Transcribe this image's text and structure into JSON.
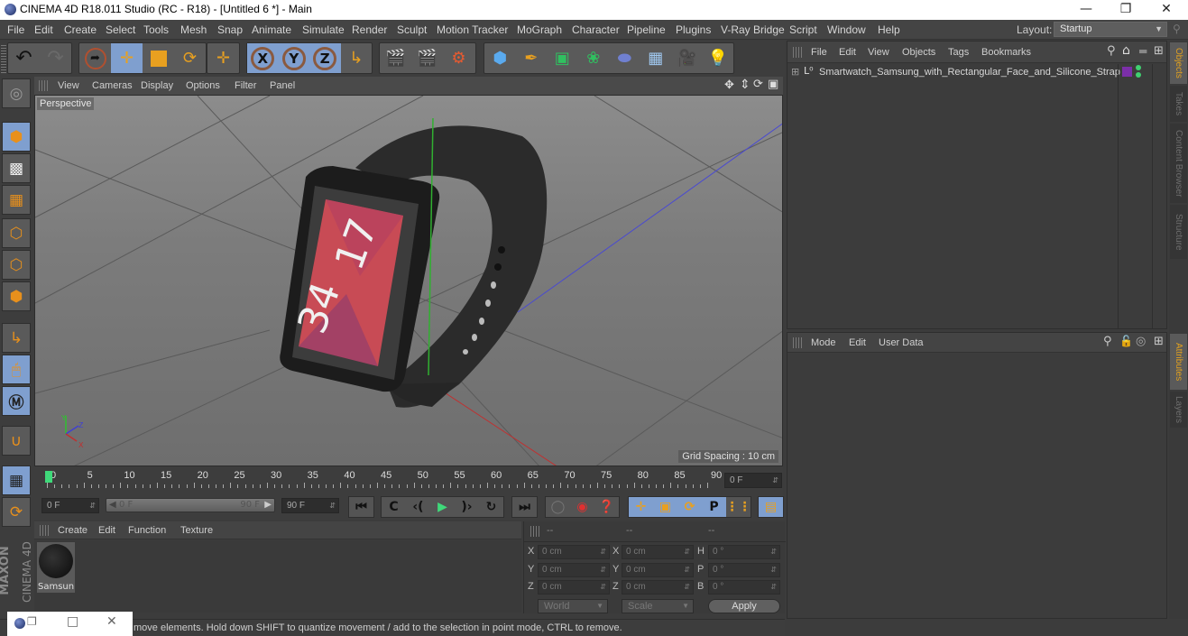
{
  "window": {
    "title": "CINEMA 4D R18.011 Studio (RC - R18) - [Untitled 6 *] - Main",
    "controls": [
      "minimize",
      "restore",
      "close"
    ]
  },
  "menubar": {
    "items": [
      "File",
      "Edit",
      "Create",
      "Select",
      "Tools",
      "Mesh",
      "Snap",
      "Animate",
      "Simulate",
      "Render",
      "Sculpt",
      "Motion Tracker",
      "MoGraph",
      "Character",
      "Pipeline",
      "Plugins",
      "V-Ray Bridge",
      "Script",
      "Window",
      "Help"
    ],
    "layout_label": "Layout:",
    "layout_value": "Startup"
  },
  "toolbar": {
    "groups": [
      [
        "undo-icon",
        "redo-icon"
      ],
      [
        "live-selection-icon",
        "move-icon",
        "scale-icon",
        "rotate-icon"
      ],
      [
        "recent-tool-icon"
      ],
      [
        "x-axis-lock-icon",
        "y-axis-lock-icon",
        "z-axis-lock-icon",
        "coordinate-system-icon"
      ],
      [
        "render-view-icon",
        "render-to-picture-viewer-icon",
        "render-settings-icon"
      ],
      [
        "cube-icon",
        "pen-spline-icon",
        "subdivision-surface-icon",
        "cloner-icon",
        "deformer-icon",
        "floor-icon",
        "camera-icon",
        "light-icon"
      ]
    ],
    "axis_labels": [
      "X",
      "Y",
      "Z"
    ]
  },
  "viewport": {
    "menu": [
      "View",
      "Cameras",
      "Display",
      "Options",
      "Filter",
      "Panel"
    ],
    "camera_label": "Perspective",
    "grid_spacing": "Grid Spacing : 10 cm",
    "watch_time": [
      "17",
      "34"
    ],
    "nav_icons": [
      "move-view-icon",
      "zoom-view-icon",
      "rotate-view-icon",
      "toggle-view-icon"
    ]
  },
  "left_tools": [
    "make-editable-icon",
    "model-mode-icon",
    "texture-mode-icon",
    "workplane-mode-icon",
    "points-mode-icon",
    "edges-mode-icon",
    "polygons-mode-icon",
    "axis-mode-icon",
    "tweak-mode-icon",
    "solo-mode-icon",
    "snap-icon",
    "workplane-lock-icon",
    "planar-workplane-icon"
  ],
  "timeline": {
    "ticks": [
      "0",
      "5",
      "10",
      "15",
      "20",
      "25",
      "30",
      "35",
      "40",
      "45",
      "50",
      "55",
      "60",
      "65",
      "70",
      "75",
      "80",
      "85",
      "90"
    ],
    "current_frame": "0 F",
    "start_field": "0 F",
    "range_start": "0 F",
    "range_end": "90 F",
    "end_field": "90 F",
    "playhead_fraction": 0.0
  },
  "playback": {
    "buttons": [
      "go-to-start-icon",
      "previous-key-icon",
      "previous-frame-icon",
      "play-icon",
      "next-frame-icon",
      "next-key-icon",
      "go-to-end-icon"
    ],
    "record_buttons": [
      "motion-record-icon",
      "record-active-objects-icon",
      "autokeying-icon"
    ],
    "key_buttons": [
      "record-position-icon",
      "record-scale-icon",
      "record-rotation-icon",
      "record-parameter-icon",
      "record-point-level-icon"
    ],
    "timeline_button": "timeline-window-icon",
    "param_label": "P"
  },
  "material_manager": {
    "menu": [
      "Create",
      "Edit",
      "Function",
      "Texture"
    ],
    "materials": [
      {
        "name": "Samsun"
      }
    ]
  },
  "coordinates": {
    "headers": [
      "--",
      "--",
      "--"
    ],
    "rows": [
      {
        "pos_label": "X",
        "pos": "0 cm",
        "size_label": "X",
        "size": "0 cm",
        "rot_label": "H",
        "rot": "0 °"
      },
      {
        "pos_label": "Y",
        "pos": "0 cm",
        "size_label": "Y",
        "size": "0 cm",
        "rot_label": "P",
        "rot": "0 °"
      },
      {
        "pos_label": "Z",
        "pos": "0 cm",
        "size_label": "Z",
        "size": "0 cm",
        "rot_label": "B",
        "rot": "0 °"
      }
    ],
    "space_select": "World",
    "mode_select": "Scale",
    "apply_label": "Apply"
  },
  "objects_panel": {
    "menu": [
      "File",
      "Edit",
      "View",
      "Objects",
      "Tags",
      "Bookmarks"
    ],
    "objects": [
      {
        "name": "Smartwatch_Samsung_with_Rectangular_Face_and_Silicone_Strap",
        "tag_color": "#7b2fa8"
      }
    ]
  },
  "attributes_panel": {
    "menu": [
      "Mode",
      "Edit",
      "User Data"
    ]
  },
  "side_tabs_top": [
    "Objects",
    "Takes",
    "Content Browser",
    "Structure"
  ],
  "side_tabs_bottom": [
    "Attributes",
    "Layers"
  ],
  "brand": {
    "line1": "MAXON",
    "line2": "CINEMA 4D"
  },
  "status": {
    "text": "move elements. Hold down SHIFT to quantize movement / add to the selection in point mode, CTRL to remove."
  },
  "colors": {
    "accent": "#e8a020",
    "selected": "#7f9fcf",
    "playhead": "#3fd97a"
  }
}
